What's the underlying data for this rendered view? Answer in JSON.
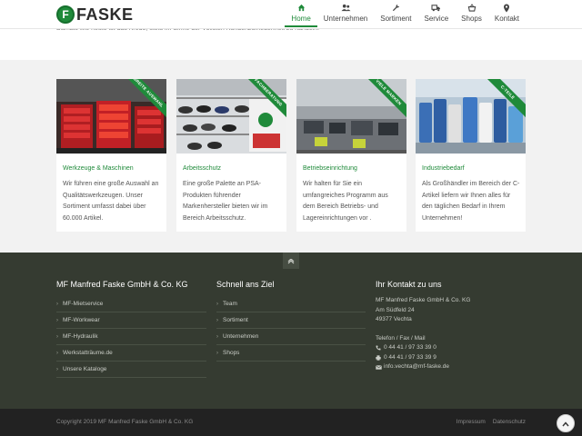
{
  "brand": {
    "name": "FASKE",
    "badge": "F",
    "accent": "#1f8a3a"
  },
  "nav": {
    "items": [
      {
        "label": "Home",
        "icon": "home-icon",
        "active": true
      },
      {
        "label": "Unternehmen",
        "icon": "users-icon"
      },
      {
        "label": "Sortiment",
        "icon": "wrench-icon"
      },
      {
        "label": "Service",
        "icon": "truck-icon"
      },
      {
        "label": "Shops",
        "icon": "basket-icon"
      },
      {
        "label": "Kontakt",
        "icon": "map-marker-icon"
      }
    ]
  },
  "intro_text": "Damals wie heute ist das Kredo, stets im Sinne der Vollsten Kundenzufriedenheit zu handeln.",
  "cards": [
    {
      "ribbon": "BREITE AUSWAHL",
      "title": "Werkzeuge & Maschinen",
      "text": "Wir führen eine große Auswahl an Qualitätswerkzeugen. Unser Sortiment umfasst dabei über 60.000 Artikel."
    },
    {
      "ribbon": "FACHBERATUNG",
      "title": "Arbeitsschutz",
      "text": "Eine große Palette an PSA-Produkten führender Markenhersteller bieten wir im Bereich Arbeitsschutz."
    },
    {
      "ribbon": "VIELE MARKEN",
      "title": "Betriebseinrichtung",
      "text": "Wir halten für Sie ein umfangreiches Programm aus dem Bereich Betriebs- und Lagereinrichtungen vor ."
    },
    {
      "ribbon": "C-TEILE",
      "title": "Industriebedarf",
      "text": "Als Großhändler im Bereich der C- Artikel liefern wir Ihnen alles für den täglichen Bedarf in Ihrem Unternehmen!"
    }
  ],
  "footer": {
    "col1": {
      "heading": "MF Manfred Faske GmbH & Co. KG",
      "links": [
        "MF-Mietservice",
        "MF-Workwear",
        "MF-Hydraulik",
        "Werkstatträume.de",
        "Unsere Kataloge"
      ]
    },
    "col2": {
      "heading": "Schnell ans Ziel",
      "links": [
        "Team",
        "Sortiment",
        "Unternehmen",
        "Shops"
      ]
    },
    "col3": {
      "heading": "Ihr Kontakt zu uns",
      "company": "MF Manfred Faske GmbH & Co. KG",
      "street": "Am Südfeld 24",
      "city": "49377 Vechta",
      "phone_label": "Telefon / Fax / Mail",
      "phone": "0 44 41 / 97 33 39 0",
      "fax": "0 44 41 / 97 33 39 9",
      "email": "info.vechta@mf-faske.de"
    }
  },
  "bottom": {
    "copyright": "Copyright 2019 MF Manfred Faske GmbH & Co. KG",
    "links": [
      "Impressum",
      "Datenschutz"
    ]
  }
}
